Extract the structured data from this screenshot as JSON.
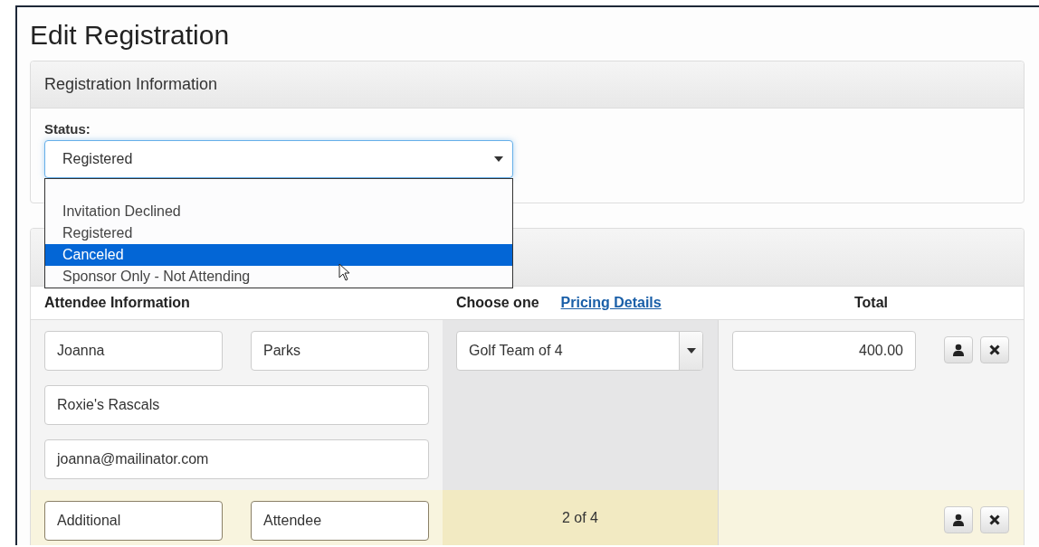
{
  "page_title": "Edit Registration",
  "registration_panel": {
    "title": "Registration Information",
    "status_label": "Status:",
    "status_value": "Registered",
    "expanded": true,
    "options": [
      {
        "label": "Invitation Declined",
        "selected": false
      },
      {
        "label": "Registered",
        "selected": false
      },
      {
        "label": "Canceled",
        "selected": true
      },
      {
        "label": "Sponsor Only - Not Attending",
        "selected": false
      }
    ]
  },
  "attendees_panel": {
    "columns": {
      "attendee": "Attendee Information",
      "choose": "Choose one",
      "pricing_link": "Pricing Details",
      "total": "Total"
    },
    "rows": [
      {
        "kind": "primary",
        "first_name": "Joanna",
        "last_name": "Parks",
        "team": "Roxie's Rascals",
        "email": "joanna@mailinator.com",
        "package": "Golf Team of 4",
        "total": "400.00"
      },
      {
        "kind": "additional",
        "first_name": "Additional",
        "last_name": "Attendee",
        "slot": "2 of 4"
      }
    ]
  }
}
